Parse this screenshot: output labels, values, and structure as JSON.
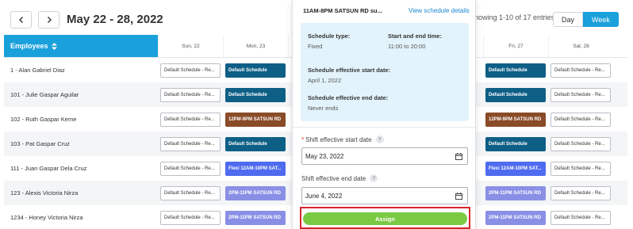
{
  "header": {
    "date_range": "May 22 - 28, 2022",
    "entries_info": "howing 1-10 of 17 entries",
    "view_day": "Day",
    "view_week": "Week"
  },
  "table": {
    "employees_header": "Employees",
    "days": [
      "Sun, 22",
      "Mon, 23",
      "",
      "",
      "",
      "Fri, 27",
      "Sat, 28"
    ],
    "rows": [
      {
        "name": "1 - Alan Gabriel Diaz",
        "cells": [
          "Default Schedule - Re...",
          "Default Schedule",
          "",
          "",
          "",
          "Default Schedule",
          "Default Schedule - Re..."
        ]
      },
      {
        "name": "101 - Julie Gaspar Aguilar",
        "cells": [
          "Default Schedule - Re...",
          "Default Schedule",
          "",
          "",
          "",
          "Default Schedule",
          "Default Schedule - Re..."
        ]
      },
      {
        "name": "102 - Ruth Gaspar Keme",
        "cells": [
          "Default Schedule - Re...",
          "12PM-9PM SATSUN RD",
          "",
          "",
          "",
          "12PM-9PM SATSUN RD",
          "Default Schedule - Re..."
        ]
      },
      {
        "name": "103 - Pat Gaspar Cruz",
        "cells": [
          "Default Schedule - Re...",
          "Default Schedule",
          "",
          "",
          "",
          "Default Schedule",
          "Default Schedule - Re..."
        ]
      },
      {
        "name": "111 - Juan Gaspar Dela Cruz",
        "cells": [
          "Default Schedule - Re...",
          "Flexi 12AM-10PM SAT...",
          "",
          "",
          "",
          "Flexi 12AM-10PM SAT...",
          "Default Schedule - Re..."
        ]
      },
      {
        "name": "123 - Alexis Victoria Nirza",
        "cells": [
          "Default Schedule - Re...",
          "2PM-11PM SATSUN RD",
          "",
          "",
          "",
          "2PM-11PM SATSUN RD",
          "Default Schedule - Re..."
        ]
      },
      {
        "name": "1234 - Honey Victoria Nirza",
        "cells": [
          "Default Schedule - Re...",
          "2PM-11PM SATSUN RD",
          "",
          "",
          "",
          "2PM-11PM SATSUN RD",
          "Default Schedule - Re..."
        ]
      }
    ]
  },
  "popover": {
    "title": "11AM-8PM SATSUN RD su...",
    "view_link": "View schedule details",
    "schedule_type_label": "Schedule type:",
    "schedule_type_value": "Fixed",
    "start_end_label": "Start and end time:",
    "start_end_value": "11:00 to 20:00",
    "effective_start_label": "Schedule effective start date:",
    "effective_start_value": "April 1, 2022",
    "effective_end_label": "Schedule effective end date:",
    "effective_end_value": "Never ends",
    "shift_start_label": "Shift effective start date",
    "shift_start_value": "May 23, 2022",
    "shift_end_label": "Shift effective end date",
    "shift_end_value": "June 4, 2022",
    "help_glyph": "?",
    "assign_label": "Assign"
  },
  "colors": {
    "accent": "#1aa0db",
    "default_schedule": "#0e5f86",
    "satsun_12pm": "#8a4b28",
    "flexi": "#4f6bef",
    "satsun_2pm": "#8a8fe6",
    "assign": "#7ac943",
    "highlight": "#d7262e"
  }
}
